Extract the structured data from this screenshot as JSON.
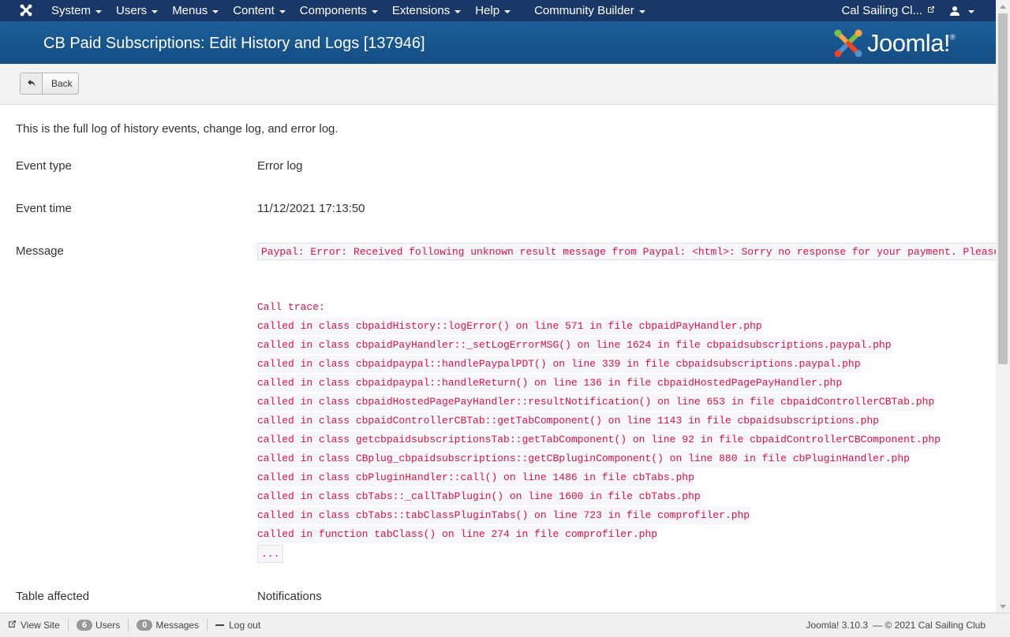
{
  "navbar": {
    "menus": [
      "System",
      "Users",
      "Menus",
      "Content",
      "Components",
      "Extensions",
      "Help"
    ],
    "community_builder": "Community Builder",
    "site_link": "Cal Sailing Cl...",
    "icons": {
      "brand": "joomla-icon",
      "external": "external-link-icon",
      "user": "user-icon"
    }
  },
  "header": {
    "title": "CB Paid Subscriptions: Edit History and Logs [137946]",
    "logo_text": "Joomla!",
    "logo_mark": "®"
  },
  "toolbar": {
    "back_label": "Back",
    "back_icon": "undo-arrow-icon"
  },
  "content": {
    "intro": "This is the full log of history events, change log, and error log.",
    "fields": {
      "event_type_label": "Event type",
      "event_type_value": "Error log",
      "event_time_label": "Event time",
      "event_time_value": "11/12/2021 17:13:50",
      "message_label": "Message",
      "message_value": "Paypal: Error: Received following unknown result message from Paypal: <html>: Sorry no response for your payment. Please",
      "table_label": "Table affected",
      "table_value": "Notifications"
    },
    "trace_header": "Call trace:",
    "trace": [
      "called in class cbpaidHistory::logError() on line 571 in file cbpaidPayHandler.php",
      "called in class cbpaidPayHandler::_setLogErrorMSG() on line 1624 in file cbpaidsubscriptions.paypal.php",
      "called in class cbpaidpaypal::handlePaypalPDT() on line 339 in file cbpaidsubscriptions.paypal.php",
      "called in class cbpaidpaypal::handleReturn() on line 136 in file cbpaidHostedPagePayHandler.php",
      "called in class cbpaidHostedPagePayHandler::resultNotification() on line 653 in file cbpaidControllerCBTab.php",
      "called in class cbpaidControllerCBTab::getTabComponent() on line 1143 in file cbpaidsubscriptions.php",
      "called in class getcbpaidsubscriptionsTab::getTabComponent() on line 92 in file cbpaidControllerCBComponent.php",
      "called in class CBplug_cbpaidsubscriptions::getCBpluginComponent() on line 880 in file cbPluginHandler.php",
      "called in class cbPluginHandler::call() on line 1486 in file cbTabs.php",
      "called in class cbTabs::_callTabPlugin() on line 1600 in file cbTabs.php",
      "called in class cbTabs::tabClassPluginTabs() on line 723 in file comprofiler.php",
      "called in function tabClass() on line 274 in file comprofiler.php"
    ],
    "trace_ellipsis": "..."
  },
  "statusbar": {
    "view_site": "View Site",
    "users_count": "6",
    "users_label": "Users",
    "messages_count": "0",
    "messages_label": "Messages",
    "logout": "Log out",
    "version": "Joomla! 3.10.3",
    "copyright": "— © 2021 Cal Sailing Club"
  }
}
